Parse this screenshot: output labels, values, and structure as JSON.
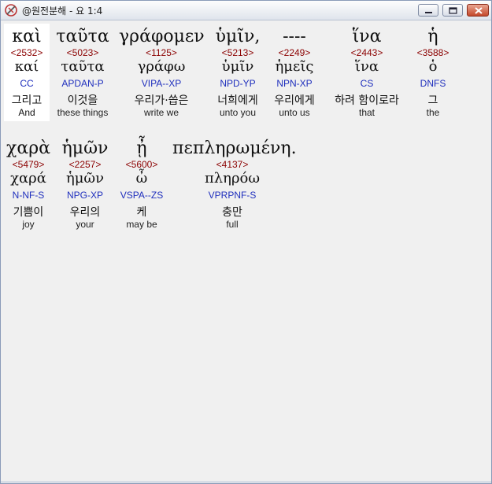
{
  "window": {
    "title": "@원전분해 - 요 1:4",
    "controls": {
      "minimize_icon": "minimize-icon",
      "maximize_icon": "maximize-icon",
      "close_icon": "close-icon"
    }
  },
  "colors": {
    "strong": "#8b0000",
    "parse": "#1f2fbd",
    "selected_bg": "#ffffff",
    "panel_bg": "#f0f0f0"
  },
  "rows": [
    {
      "words": [
        {
          "greek": "καὶ",
          "strong": "<2532>",
          "lemma": "καί",
          "parse": "CC",
          "korean": "그리고",
          "english": "And",
          "selected": true
        },
        {
          "greek": "ταῦτα",
          "strong": "<5023>",
          "lemma": "ταῦτα",
          "parse": "APDAN-P",
          "korean": "이것을",
          "english": "these things",
          "selected": false
        },
        {
          "greek": "γράφομεν",
          "strong": "<1125>",
          "lemma": "γράφω",
          "parse": "VIPA--XP",
          "korean": "우리가·씁은",
          "english": "write we",
          "selected": false
        },
        {
          "greek": "ὑμῖν,",
          "strong": "<5213>",
          "lemma": "ὑμῖν",
          "parse": "NPD-YP",
          "korean": "너희에게",
          "english": "unto you",
          "selected": false
        },
        {
          "greek": "----",
          "strong": "<2249>",
          "lemma": "ἡμεῖς",
          "parse": "NPN-XP",
          "korean": "우리에게",
          "english": "unto us",
          "selected": false
        },
        {
          "greek": "ἵνα",
          "strong": "<2443>",
          "lemma": "ἵνα",
          "parse": "CS",
          "korean": "하려 함이로라",
          "english": "that",
          "selected": false
        },
        {
          "greek": "ἡ",
          "strong": "<3588>",
          "lemma": "ὁ",
          "parse": "DNFS",
          "korean": "그",
          "english": "the",
          "selected": false
        }
      ]
    },
    {
      "words": [
        {
          "greek": "χαρὰ",
          "strong": "<5479>",
          "lemma": "χαρά",
          "parse": "N-NF-S",
          "korean": "기쁨이",
          "english": "joy",
          "selected": false
        },
        {
          "greek": "ἡμῶν",
          "strong": "<2257>",
          "lemma": "ἡμῶν",
          "parse": "NPG-XP",
          "korean": "우리의",
          "english": "your",
          "selected": false
        },
        {
          "greek": "ᾖ",
          "strong": "<5600>",
          "lemma": "ὦ",
          "parse": "VSPA--ZS",
          "korean": "케",
          "english": "may be",
          "selected": false
        },
        {
          "greek": "πεπληρωμένη.",
          "strong": "<4137>",
          "lemma": "πληρόω",
          "parse": "VPRPNF-S",
          "korean": "충만",
          "english": "full",
          "selected": false
        }
      ]
    }
  ]
}
